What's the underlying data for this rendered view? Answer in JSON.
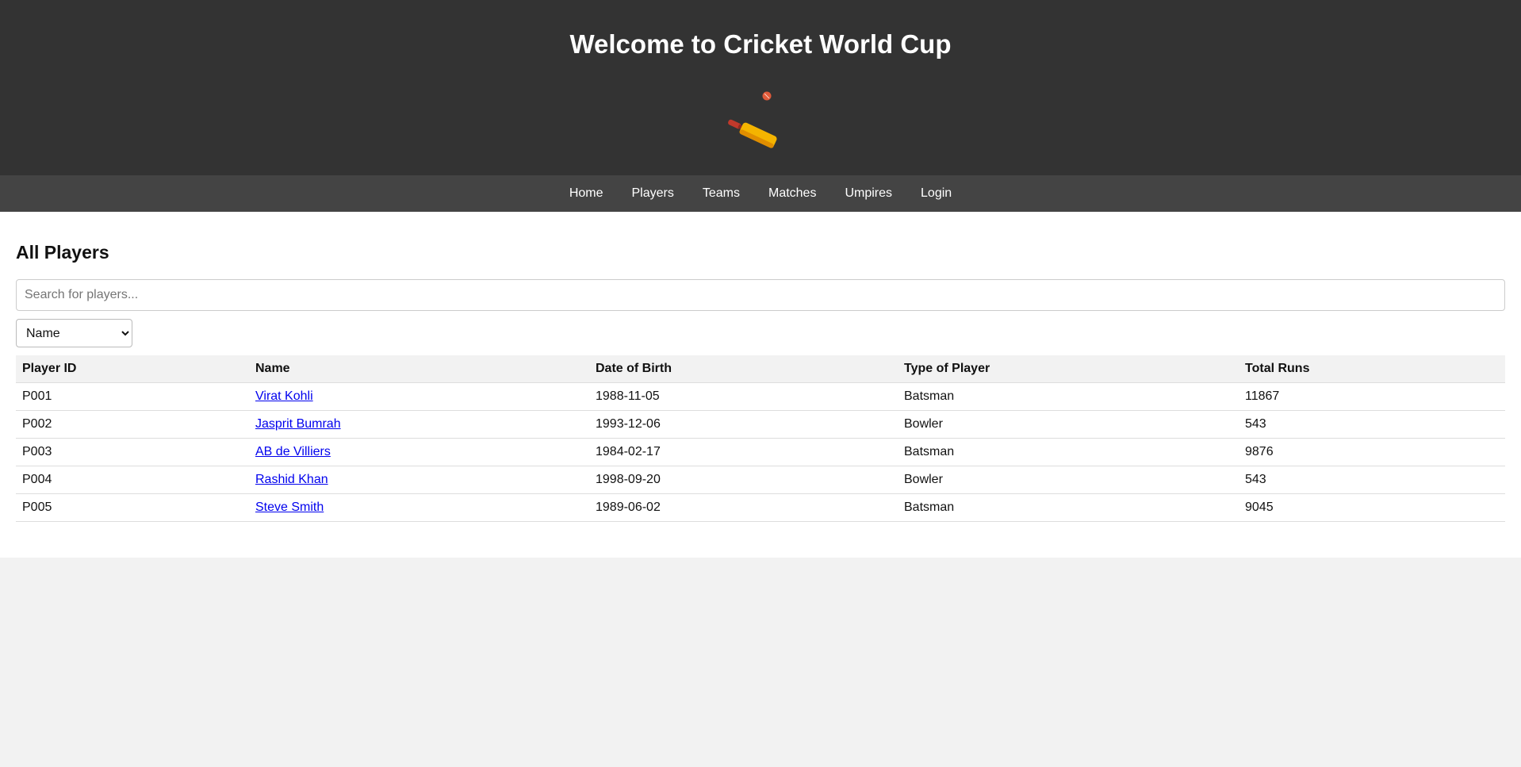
{
  "header": {
    "title": "Welcome to Cricket World Cup"
  },
  "nav": {
    "items": [
      "Home",
      "Players",
      "Teams",
      "Matches",
      "Umpires",
      "Login"
    ]
  },
  "main": {
    "heading": "All Players",
    "search": {
      "placeholder": "Search for players...",
      "value": ""
    },
    "sort": {
      "selected": "Name"
    },
    "table": {
      "columns": [
        "Player ID",
        "Name",
        "Date of Birth",
        "Type of Player",
        "Total Runs"
      ],
      "rows": [
        [
          "P001",
          "Virat Kohli",
          "1988-11-05",
          "Batsman",
          "11867"
        ],
        [
          "P002",
          "Jasprit Bumrah",
          "1993-12-06",
          "Bowler",
          "543"
        ],
        [
          "P003",
          "AB de Villiers",
          "1984-02-17",
          "Batsman",
          "9876"
        ],
        [
          "P004",
          "Rashid Khan",
          "1998-09-20",
          "Bowler",
          "543"
        ],
        [
          "P005",
          "Steve Smith",
          "1989-06-02",
          "Batsman",
          "9045"
        ]
      ]
    }
  },
  "icons": {
    "logo": "cricket-bat-and-ball-icon"
  },
  "colors": {
    "header_bg": "#333333",
    "nav_bg": "#444444",
    "link": "#0000ee",
    "ball": "#e05a3a",
    "bat": "#f4b400"
  }
}
